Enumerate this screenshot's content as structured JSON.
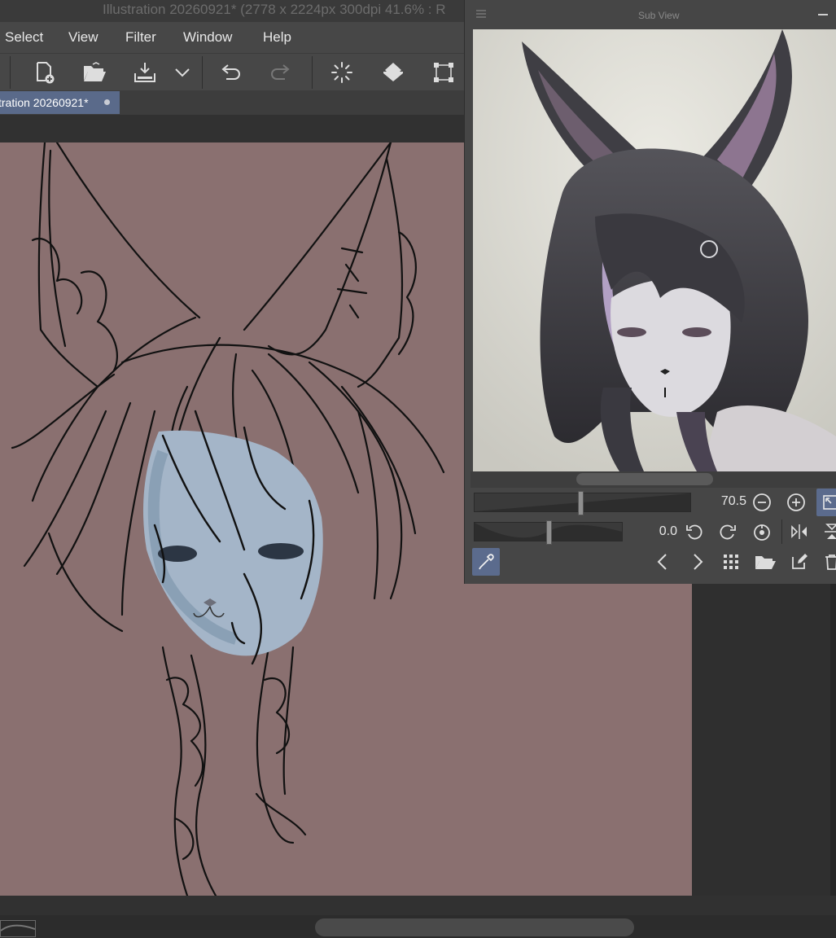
{
  "window": {
    "title": "Illustration 20260921* (2778 x 2224px 300dpi 41.6% : R"
  },
  "menu": {
    "items": [
      "Select",
      "View",
      "Filter",
      "Window",
      "Help"
    ]
  },
  "toolbar": {
    "icons": [
      "new-file-icon",
      "open-folder-icon",
      "save-icon",
      "dropdown-chevron-icon",
      "undo-icon",
      "redo-icon",
      "loading-spinner-icon",
      "fill-bucket-icon",
      "transform-icon"
    ]
  },
  "tabs": [
    {
      "label": "tration 20260921*",
      "modified": true
    }
  ],
  "subview": {
    "title": "Sub View",
    "zoom_value": "70.5",
    "zoom_fraction": 0.49,
    "rotate_value": "0.0",
    "rotate_fraction": 0.5
  },
  "colors": {
    "canvas_bg": "#8a7070",
    "accent": "#5b6b8d",
    "panel_bg": "#464646"
  }
}
